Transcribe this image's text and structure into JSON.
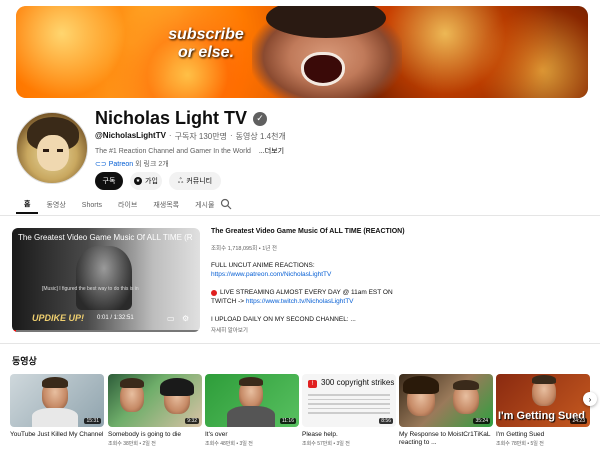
{
  "banner": {
    "text_line1": "subscribe",
    "text_line2": "or else."
  },
  "channel": {
    "name": "Nicholas Light TV",
    "verified_icon": "verified-check-icon",
    "handle": "@NicholasLightTV",
    "subscribers": "구독자 130만명",
    "videos": "동영상 1.4천개",
    "separator": "·",
    "description": "The #1 Reaction Channel and Gamer In the World",
    "more_label": "...더보기",
    "link_text": "Patreon",
    "link_extra": "외 링크 2개"
  },
  "buttons": {
    "subscribe": "구독",
    "join": "가입",
    "community": "커뮤니티"
  },
  "tabs": [
    {
      "label": "홈",
      "active": true
    },
    {
      "label": "동영상",
      "active": false
    },
    {
      "label": "Shorts",
      "active": false
    },
    {
      "label": "라이브",
      "active": false
    },
    {
      "label": "재생목록",
      "active": false
    },
    {
      "label": "게시물",
      "active": false
    }
  ],
  "featured": {
    "overlay_title": "The Greatest Video Game Music Of ALL TIME (R",
    "caption": "[Music] I figured the best way to do this is in",
    "logo": "UPDIKE UP!",
    "time": "0:01 / 1:32:51",
    "progress": 0.01,
    "title": "The Greatest Video Game Music Of ALL TIME (REACTION)",
    "meta": "조회수 1,718,095회 • 1년 전",
    "desc1": "FULL UNCUT ANIME REACTIONS:",
    "url1": "https://www.patreon.com/NicholasLightTV",
    "desc2": "LIVE STREAMING ALMOST EVERY DAY @ 11am EST ON",
    "desc3_prefix": "TWITCH -> ",
    "url2": "https://www.twitch.tv/NicholasLightTV",
    "desc4": "I UPLOAD DAILY ON MY SECOND CHANNEL: ...",
    "more": "자세히 알아보기"
  },
  "shelf": {
    "title": "동영상",
    "videos": [
      {
        "title": "YouTube Just Killed My Channel",
        "meta": "조회수 ...",
        "duration": "15:31"
      },
      {
        "title": "Somebody is going to die",
        "meta": "조회수 38만회 • 2일 전",
        "duration": "9:32"
      },
      {
        "title": "It's over",
        "meta": "조회수 48만회 • 3일 전",
        "duration": "11:16"
      },
      {
        "title": "Please help.",
        "meta": "조회수 57만회 • 3일 전",
        "duration": "8:56",
        "thumb_text": "300 copyright strikes"
      },
      {
        "title": "My Response to MoistCr1TiKaL reacting to ...",
        "meta": "조회수 ...",
        "duration": "35:24"
      },
      {
        "title": "I'm Getting Sued",
        "meta": "조회수 78만회 • 5일 전",
        "duration": "24:23",
        "thumb_text": "I'm Getting Sued"
      }
    ]
  },
  "icons": {
    "search": "search-icon",
    "next": "chevron-right-icon",
    "settings": "settings-icon",
    "caption": "captions-icon"
  }
}
